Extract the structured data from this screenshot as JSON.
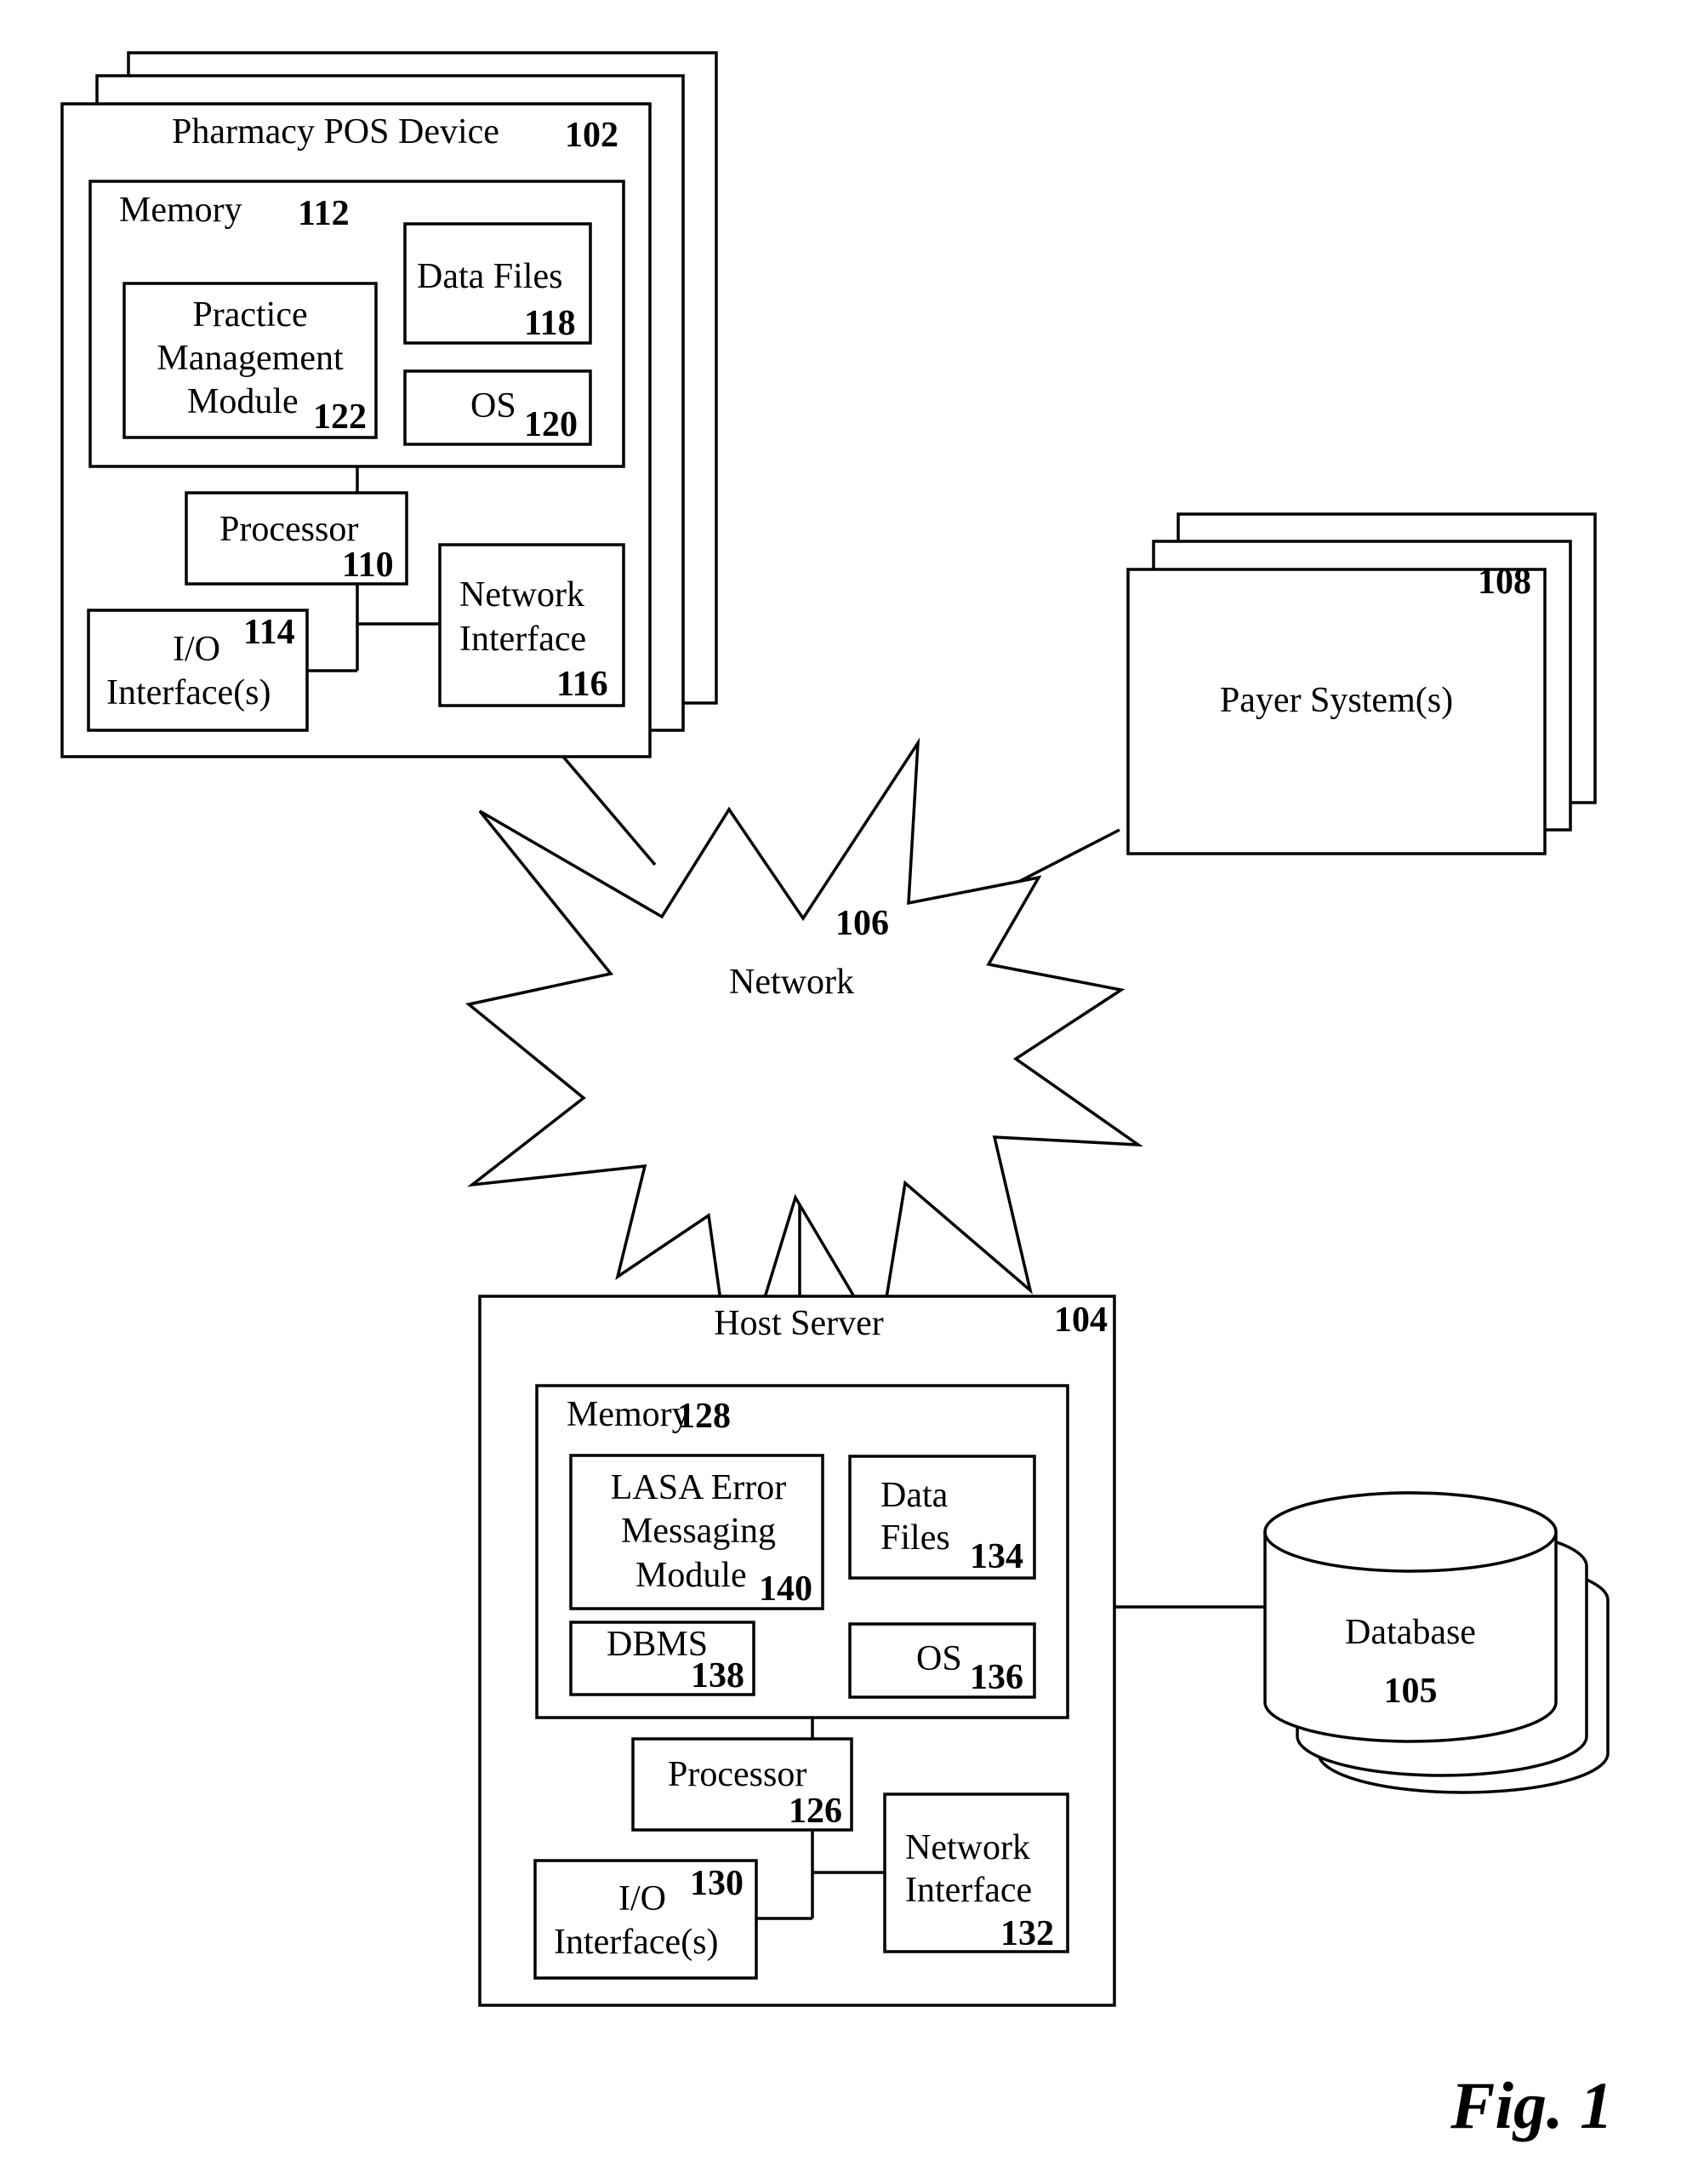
{
  "figure_label": "Fig. 1",
  "pos_device": {
    "title": "Pharmacy POS Device",
    "ref": "102",
    "memory": {
      "title": "Memory",
      "ref": "112",
      "practice_module": {
        "line1": "Practice",
        "line2": "Management",
        "line3": "Module",
        "ref": "122"
      },
      "data_files": {
        "label": "Data Files",
        "ref": "118"
      },
      "os": {
        "label": "OS",
        "ref": "120"
      }
    },
    "processor": {
      "label": "Processor",
      "ref": "110"
    },
    "io": {
      "line1": "I/O",
      "line2": "Interface(s)",
      "ref": "114"
    },
    "network_interface": {
      "line1": "Network",
      "line2": "Interface",
      "ref": "116"
    }
  },
  "network": {
    "label": "Network",
    "ref": "106"
  },
  "payer_system": {
    "label": "Payer System(s)",
    "ref": "108"
  },
  "host_server": {
    "title": "Host Server",
    "ref": "104",
    "memory": {
      "title": "Memory",
      "ref": "128",
      "lasa_module": {
        "line1": "LASA Error",
        "line2": "Messaging",
        "line3": "Module",
        "ref": "140"
      },
      "data_files": {
        "line1": "Data",
        "line2": "Files",
        "ref": "134"
      },
      "dbms": {
        "label": "DBMS",
        "ref": "138"
      },
      "os": {
        "label": "OS",
        "ref": "136"
      }
    },
    "processor": {
      "label": "Processor",
      "ref": "126"
    },
    "io": {
      "line1": "I/O",
      "line2": "Interface(s)",
      "ref": "130"
    },
    "network_interface": {
      "line1": "Network",
      "line2": "Interface",
      "ref": "132"
    }
  },
  "database": {
    "label": "Database",
    "ref": "105"
  }
}
